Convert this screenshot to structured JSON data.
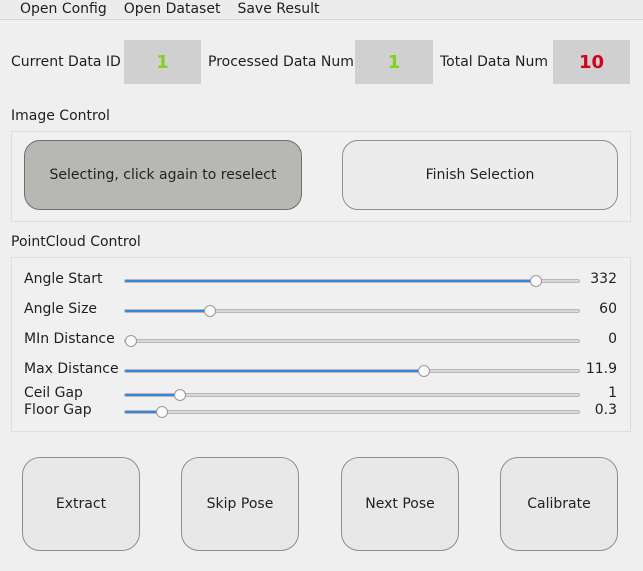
{
  "menu": [
    "Open Config",
    "Open Dataset",
    "Save Result"
  ],
  "status": {
    "current_label": "Current Data ID",
    "current_value": "1",
    "processed_label": "Processed Data Num",
    "processed_value": "1",
    "total_label": "Total Data Num",
    "total_value": "10",
    "colors": {
      "ok": "#7ed321",
      "alert": "#d0021b"
    }
  },
  "image_control": {
    "title": "Image Control",
    "select_label": "Selecting, click again to reselect",
    "finish_label": "Finish Selection"
  },
  "pointcloud_control": {
    "title": "PointCloud Control",
    "sliders": [
      {
        "label": "Angle Start",
        "value": "332",
        "fraction": 0.912
      },
      {
        "label": "Angle Size",
        "value": "60",
        "fraction": 0.178
      },
      {
        "label": "MIn Distance",
        "value": "0",
        "fraction": 0.0
      },
      {
        "label": "Max Distance",
        "value": "11.9",
        "fraction": 0.659
      },
      {
        "label": "Ceil Gap",
        "value": "1",
        "fraction": 0.11
      },
      {
        "label": "Floor Gap",
        "value": "0.3",
        "fraction": 0.07
      }
    ]
  },
  "actions": [
    "Extract",
    "Skip Pose",
    "Next Pose",
    "Calibrate"
  ]
}
